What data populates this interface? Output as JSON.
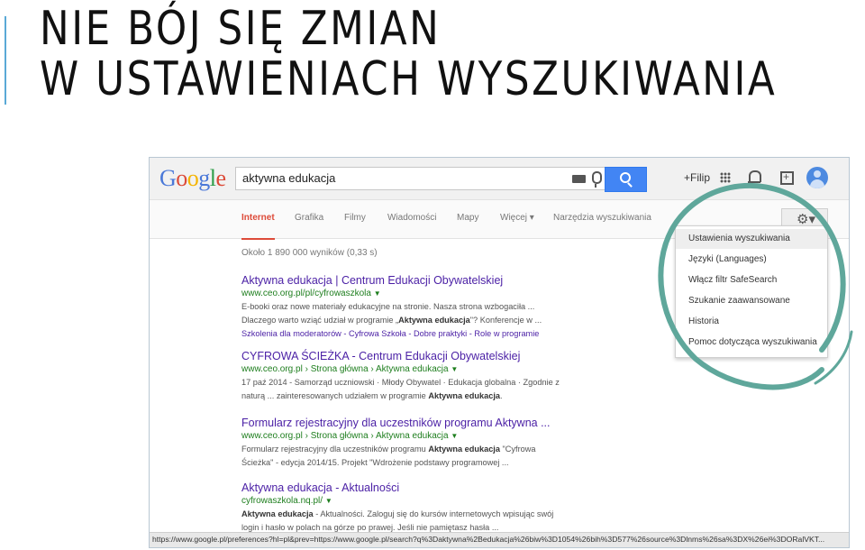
{
  "slide": {
    "title_line1": "NIE BÓJ SIĘ ZMIAN",
    "title_line2": "W USTAWIENIACH WYSZUKIWANIA"
  },
  "google": {
    "logo": {
      "G": "G",
      "o1": "o",
      "o2": "o",
      "g": "g",
      "l": "l",
      "e": "e"
    },
    "query": "aktywna edukacja",
    "user": "+Filip",
    "icons": [
      "keyboard-icon",
      "microphone-icon",
      "search-icon",
      "apps-grid-icon",
      "bell-icon",
      "share-icon",
      "avatar-icon",
      "gear-icon"
    ],
    "tabs": [
      "Internet",
      "Grafika",
      "Filmy",
      "Wiadomości",
      "Mapy",
      "Więcej ▾",
      "Narzędzia wyszukiwania"
    ],
    "active_tab": "Internet",
    "gear": "⚙▾",
    "stats": "Około 1 890 000 wyników (0,33 s)",
    "results": [
      {
        "title": "Aktywna edukacja | Centrum Edukacji Obywatelskiej",
        "url": "www.ceo.org.pl/pl/cyfrowaszkola",
        "s1": "E-booki oraz nowe materiały edukacyjne na stronie. Nasza strona wzbogaciła ...",
        "s2_pre": "Dlaczego warto wziąć udział w programie „",
        "s2_bold": "Aktywna edukacja",
        "s2_post": "\"? Konferencje w ...",
        "links": "Szkolenia dla moderatorów - Cyfrowa Szkoła - Dobre praktyki - Role w programie"
      },
      {
        "title": "CYFROWA ŚCIEŻKA - Centrum Edukacji Obywatelskiej",
        "url": "www.ceo.org.pl › Strona główna › Aktywna edukacja",
        "s1": "17 paź 2014 - Samorząd uczniowski · Młody Obywatel · Edukacja globalna · Zgodnie z",
        "s2_pre": "naturą ... zainteresowanych udziałem w programie ",
        "s2_bold": "Aktywna edukacja",
        "s2_post": "."
      },
      {
        "title": "Formularz rejestracyjny dla uczestników programu Aktywna ...",
        "url": "www.ceo.org.pl › Strona główna › Aktywna edukacja",
        "s1_pre": "Formularz rejestracyjny dla uczestników programu ",
        "s1_bold": "Aktywna edukacja",
        "s1_post": " \"Cyfrowa",
        "s2": "Ścieżka\" - edycja 2014/15. Projekt \"Wdrożenie podstawy programowej ..."
      },
      {
        "title": "Aktywna edukacja - Aktualności",
        "url": "cyfrowaszkola.nq.pl/",
        "s1_bold": "Aktywna edukacja",
        "s1_post": " - Aktualności. Zaloguj się do kursów internetowych wpisując swój",
        "s2": "login i hasło w polach na górze po prawej. Jeśli nie pamiętasz hasła ..."
      }
    ],
    "menu": [
      "Ustawienia wyszukiwania",
      "Języki (Languages)",
      "Włącz filtr SafeSearch",
      "Szukanie zaawansowane",
      "Historia",
      "Pomoc dotycząca wyszukiwania"
    ],
    "status_url": "https://www.google.pl/preferences?hl=pl&prev=https://www.google.pl/search?q%3Daktywna%2Bedukacja%26biw%3D1054%26bih%3D577%26source%3Dlnms%26sa%3DX%26ei%3DORalVKT...",
    "colors": {
      "accent_tab": "#dd4b39",
      "link": "#4a1fa5",
      "url": "#1e7e1e",
      "search_button": "#4285f4",
      "annotation_circle": "#5fa79b"
    }
  }
}
